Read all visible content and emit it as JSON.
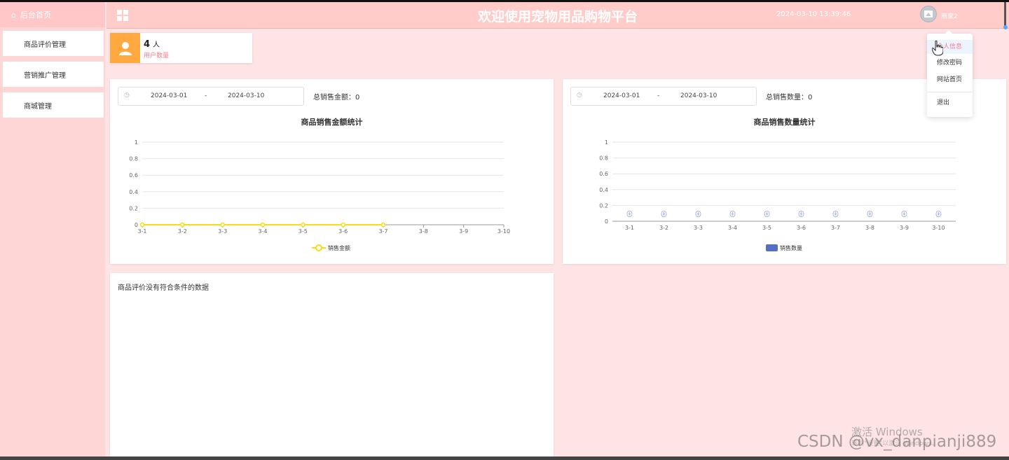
{
  "sidebar": {
    "home_label": "后台首页",
    "items": [
      {
        "label": "商品评价管理"
      },
      {
        "label": "营销推广管理"
      },
      {
        "label": "商城管理"
      }
    ]
  },
  "header": {
    "title": "欢迎使用宠物用品购物平台",
    "datetime": "2024-03-10 13:39:46",
    "user": "商家2"
  },
  "stat": {
    "value": "4",
    "unit": "人",
    "label": "用户数量"
  },
  "amount_panel": {
    "start_date": "2024-03-01",
    "separator": "-",
    "end_date": "2024-03-10",
    "total_label": "总销售金额：0"
  },
  "count_panel": {
    "start_date": "2024-03-01",
    "separator": "-",
    "end_date": "2024-03-10",
    "total_label": "总销售数量：0"
  },
  "review_panel": {
    "empty_text": "商品评价没有符合条件的数据"
  },
  "dropdown": {
    "items": [
      "个人信息",
      "修改密码",
      "网站首页"
    ],
    "logout": "退出"
  },
  "watermarks": {
    "windows_line1": "激活 Windows",
    "windows_line2": "转到\"设置\"以激活 Windows。",
    "csdn": "CSDN @vx_danpianji889"
  },
  "colors": {
    "header_bg": "#ffccc9",
    "page_bg": "#ffe4e6",
    "stat_icon_bg": "#ffa940",
    "line_series": "#fadb14",
    "bar_series": "#5470c6"
  },
  "chart_data": [
    {
      "type": "line",
      "title": "商品销售金额统计",
      "categories": [
        "3-1",
        "3-2",
        "3-3",
        "3-4",
        "3-5",
        "3-6",
        "3-7",
        "3-8",
        "3-9",
        "3-10"
      ],
      "series": [
        {
          "name": "销售金额",
          "values": [
            0,
            0,
            0,
            0,
            0,
            0,
            0,
            null,
            null,
            null
          ]
        }
      ],
      "ylim": [
        0,
        1
      ],
      "yticks": [
        "0",
        "0.2",
        "0.4",
        "0.6",
        "0.8",
        "1"
      ],
      "grid": true,
      "legend": "bottom-center"
    },
    {
      "type": "bar",
      "title": "商品销售数量统计",
      "categories": [
        "3-1",
        "3-2",
        "3-3",
        "3-4",
        "3-5",
        "3-6",
        "3-7",
        "3-8",
        "3-9",
        "3-10"
      ],
      "series": [
        {
          "name": "销售数量",
          "values": [
            0,
            0,
            0,
            0,
            0,
            0,
            0,
            0,
            0,
            0
          ]
        }
      ],
      "ylim": [
        0,
        1
      ],
      "yticks": [
        "0",
        "0.2",
        "0.4",
        "0.6",
        "0.8",
        "1"
      ],
      "grid": true,
      "legend": "bottom-center"
    }
  ]
}
